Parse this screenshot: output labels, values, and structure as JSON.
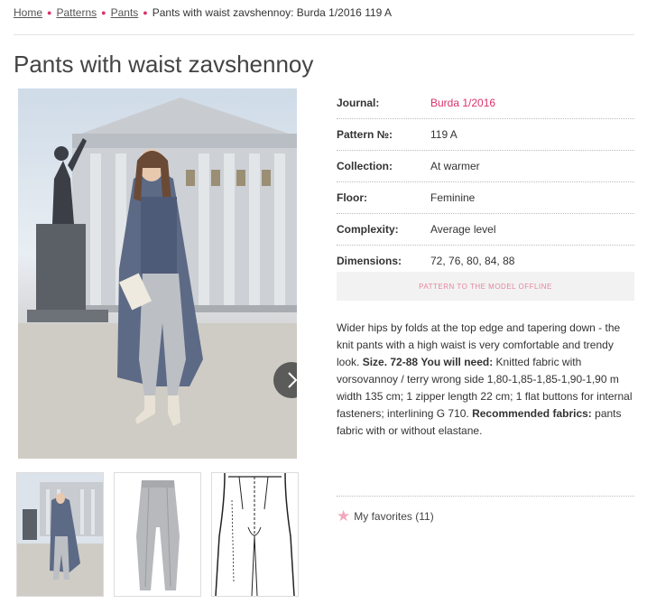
{
  "breadcrumb": {
    "items": [
      "Home",
      "Patterns",
      "Pants"
    ],
    "current": "Pants with waist zavshennoy: Burda 1/2016 119 A"
  },
  "page_title": "Pants with waist zavshennoy",
  "details": [
    {
      "label": "Journal:",
      "value": "Burda 1/2016"
    },
    {
      "label": "Pattern №:",
      "value": "119 A"
    },
    {
      "label": "Collection:",
      "value": "At warmer"
    },
    {
      "label": "Floor:",
      "value": "Feminine"
    },
    {
      "label": "Complexity:",
      "value": "Average level"
    },
    {
      "label": "Dimensions:",
      "value": "72, 76, 80, 84, 88"
    }
  ],
  "offline_button": "PATTERN TO THE MODEL OFFLINE",
  "description": {
    "intro": "Wider hips by folds at the top edge and tapering down - the knit pants with a high waist is very comfortable and trendy look.",
    "size_label": "Size. 72-88",
    "need_label": "You will need:",
    "need_text": "Knitted fabric with vorsovannoy / terry wrong side 1,80-1,85-1,85-1,90-1,90 m width 135 cm; 1 zipper length 22 cm; 1 flat buttons for internal fasteners; interlining G 710.",
    "fabrics_label": "Recommended fabrics:",
    "fabrics_text": "pants fabric with or without elastane."
  },
  "favorites": {
    "label": "My favorites (11)"
  },
  "icons": {
    "next": "chevron-right-icon",
    "star": "star-icon"
  },
  "colors": {
    "accent": "#d8326a",
    "star": "#f1a7bd",
    "offline_text": "#e6869f"
  }
}
